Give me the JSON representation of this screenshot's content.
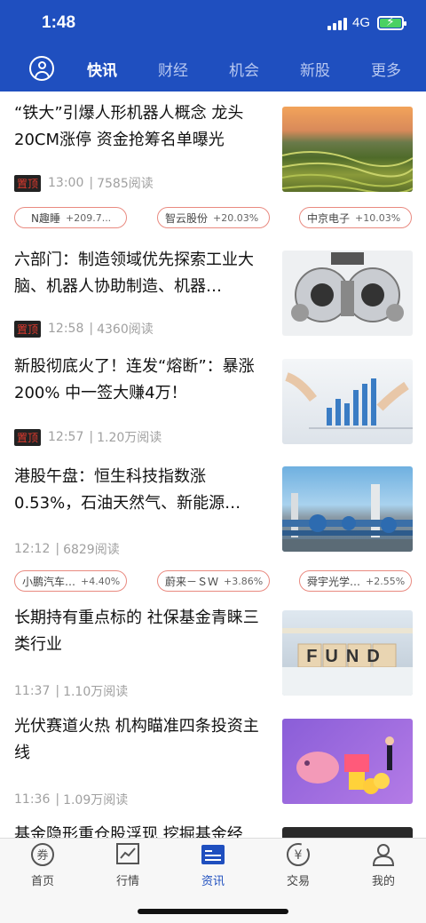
{
  "status": {
    "time": "1:48",
    "network": "4G"
  },
  "nav": {
    "tabs": [
      {
        "label": "快讯",
        "active": true
      },
      {
        "label": "财经",
        "active": false
      },
      {
        "label": "机会",
        "active": false
      },
      {
        "label": "新股",
        "active": false
      },
      {
        "label": "更多",
        "active": false
      }
    ]
  },
  "feed": [
    {
      "title": "“铁大”引爆人形机器人概念 龙头20CM涨停 资金抢筹名单曝光",
      "badge": "置顶",
      "time": "13:00",
      "reads": "7585阅读",
      "chips": [
        {
          "name": "N趣睡",
          "change": "+209.7..."
        },
        {
          "name": "智云股份",
          "change": "+20.03%"
        },
        {
          "name": "中京电子",
          "change": "+10.03%"
        }
      ]
    },
    {
      "title": "六部门：制造领域优先探索工业大脑、机器人协助制造、机器…",
      "badge": "置顶",
      "time": "12:58",
      "reads": "4360阅读"
    },
    {
      "title": "新股彻底火了！连发“熔断”：暴涨200% 中一签大赚4万！",
      "badge": "置顶",
      "time": "12:57",
      "reads": "1.20万阅读"
    },
    {
      "title": "港股午盘：恒生科技指数涨0.53%，石油天然气、新能源…",
      "time": "12:12",
      "reads": "6829阅读",
      "chips": [
        {
          "name": "小鹏汽车…",
          "change": "+4.40%"
        },
        {
          "name": "蔚来－ＳＷ",
          "change": "+3.86%"
        },
        {
          "name": "舜宇光学…",
          "change": "+2.55%"
        }
      ]
    },
    {
      "title": "长期持有重点标的 社保基金青睐三类行业",
      "time": "11:37",
      "reads": "1.10万阅读",
      "thumb_text": "FUND"
    },
    {
      "title": "光伏赛道火热 机构瞄准四条投资主线",
      "time": "11:36",
      "reads": "1.09万阅读"
    },
    {
      "title": "基金隐形重仓股浮现 挖掘基金经"
    }
  ],
  "tabbar": {
    "items": [
      {
        "label": "首页",
        "icon": "coupon-icon"
      },
      {
        "label": "行情",
        "icon": "chart-icon"
      },
      {
        "label": "资讯",
        "icon": "news-icon",
        "active": true
      },
      {
        "label": "交易",
        "icon": "yuan-icon"
      },
      {
        "label": "我的",
        "icon": "user-icon"
      }
    ]
  },
  "colors": {
    "primary": "#1f4fbf",
    "badge_text": "#e03a2e",
    "chip_border": "#e98a80"
  }
}
